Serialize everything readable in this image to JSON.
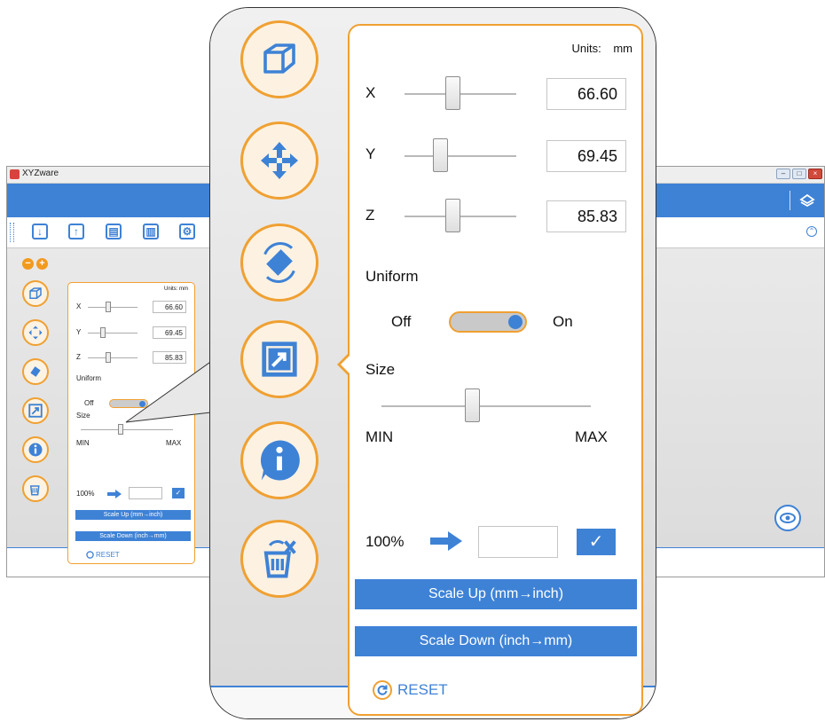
{
  "app": {
    "title": "XYZware",
    "window_buttons": [
      "–",
      "□",
      "×"
    ]
  },
  "toolbar": {
    "icons": [
      "import-icon",
      "export-icon",
      "save-icon",
      "print-icon",
      "settings-icon"
    ]
  },
  "zoom": {
    "out_label": "−",
    "in_label": "+"
  },
  "side_icons": [
    "cube-icon",
    "move-icon",
    "rotate-icon",
    "scale-icon",
    "info-icon",
    "delete-icon"
  ],
  "scale_panel": {
    "units_label": "Units:",
    "units_value": "mm",
    "x": {
      "label": "X",
      "value": "66.60",
      "slider": 0.42
    },
    "y": {
      "label": "Y",
      "value": "69.45",
      "slider": 0.3
    },
    "z": {
      "label": "Z",
      "value": "85.83",
      "slider": 0.42
    },
    "uniform_label": "Uniform",
    "off_label": "Off",
    "on_label": "On",
    "uniform_on": true,
    "size_label": "Size",
    "size_min": "MIN",
    "size_max": "MAX",
    "size_slider": 0.42,
    "percent_label": "100%",
    "percent_value": "",
    "confirm_label": "✓",
    "scale_up_label": "Scale Up (mm→inch)",
    "scale_down_label": "Scale Down (inch→mm)",
    "reset_label": "RESET"
  },
  "colors": {
    "accent_blue": "#3e82d6",
    "accent_orange": "#f0a031"
  }
}
